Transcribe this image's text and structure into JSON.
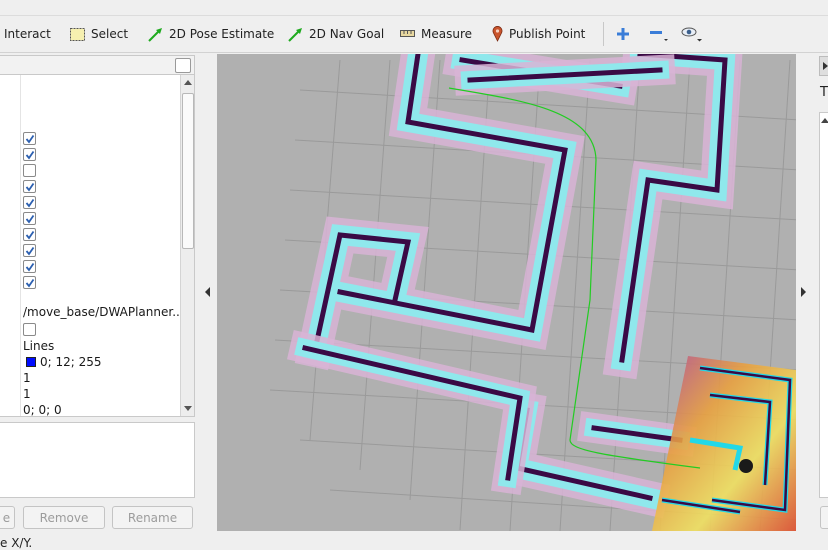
{
  "toolbar": {
    "tools": [
      {
        "id": "interact",
        "label": "Interact",
        "icon": "interact-icon"
      },
      {
        "id": "select",
        "label": "Select",
        "icon": "select-box-icon"
      },
      {
        "id": "pose",
        "label": "2D Pose Estimate",
        "icon": "green-arrow-icon"
      },
      {
        "id": "goal",
        "label": "2D Nav Goal",
        "icon": "green-arrow-icon"
      },
      {
        "id": "measure",
        "label": "Measure",
        "icon": "ruler-icon"
      },
      {
        "id": "publish",
        "label": "Publish Point",
        "icon": "map-pin-icon"
      }
    ],
    "view_tools": [
      "plus-icon",
      "minus-icon",
      "eye-icon"
    ]
  },
  "displays": {
    "checkboxes": [
      true,
      true,
      false,
      true,
      true,
      true,
      true,
      true,
      true,
      true
    ],
    "properties": {
      "topic": "/move_base/DWAPlanner..",
      "style": "Lines",
      "color": "0; 12; 255",
      "color_hex": "#000cff",
      "alpha": "1",
      "line_width": "1",
      "offset": "0; 0; 0",
      "pose_style": "None"
    },
    "buttons": {
      "add": "e",
      "remove": "Remove",
      "rename": "Rename"
    }
  },
  "right_panel": {
    "letter": "T"
  },
  "status": {
    "text": "e X/Y."
  },
  "colors": {
    "obstacle": "#3a0a45",
    "inflation": "#8fe8ec",
    "cost_halo": "#d9b4d6",
    "plan": "#22cc22",
    "grid": "#9a9a9a",
    "background": "#b0b0b0"
  }
}
